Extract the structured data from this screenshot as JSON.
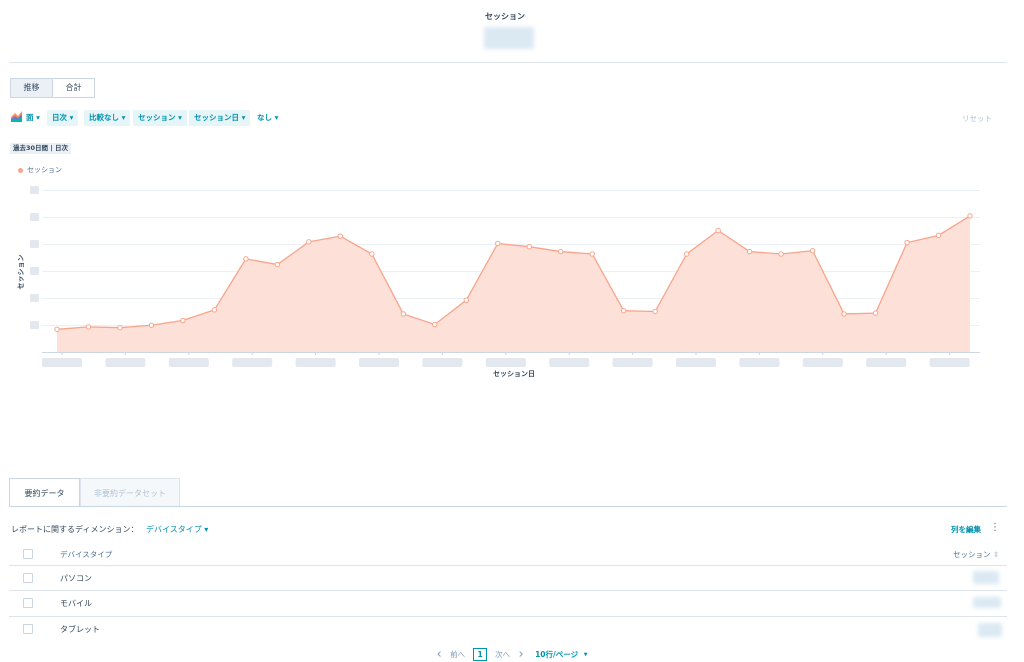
{
  "header": {
    "metric_title": "セッション"
  },
  "view_toggle": {
    "trend_label": "推移",
    "total_label": "合計",
    "active": "trend"
  },
  "chart_controls": {
    "chart_type_label": "面",
    "frequency_label": "日次",
    "comparison_label": "比較なし",
    "measure_label": "セッション",
    "dimension_label": "セッション日",
    "breakdown_label": "なし",
    "reset_label": "リセット"
  },
  "date_range_badge": "過去30日間 | 日次",
  "colors": {
    "series_fill": "#fde0d8",
    "series_stroke": "#f8a48a",
    "accent": "#0091ae"
  },
  "chart_data": {
    "type": "area",
    "legend": [
      "セッション"
    ],
    "legend_placement": "top-left",
    "xlabel": "セッション日",
    "ylabel": "セッション",
    "grid": true,
    "ylim": [
      0,
      1
    ],
    "series": [
      {
        "name": "セッション",
        "values": [
          0.14,
          0.155,
          0.15,
          0.165,
          0.195,
          0.26,
          0.575,
          0.54,
          0.68,
          0.715,
          0.605,
          0.235,
          0.17,
          0.32,
          0.67,
          0.65,
          0.62,
          0.605,
          0.255,
          0.25,
          0.605,
          0.75,
          0.62,
          0.605,
          0.625,
          0.235,
          0.24,
          0.675,
          0.72,
          0.84
        ]
      }
    ]
  },
  "tabs": {
    "summary_label": "要約データ",
    "non_summary_label": "非要約データセット"
  },
  "table": {
    "dimension_prompt": "レポートに関するディメンション：",
    "dimension_value": "デバイスタイプ",
    "edit_columns_label": "列を編集",
    "columns": [
      "デバイスタイプ",
      "セッション"
    ],
    "rows": [
      {
        "device": "パソコン"
      },
      {
        "device": "モバイル"
      },
      {
        "device": "タブレット"
      }
    ]
  },
  "pagination": {
    "prev_label": "前へ",
    "current_page": "1",
    "next_label": "次へ",
    "per_page_label": "10行/ページ"
  }
}
